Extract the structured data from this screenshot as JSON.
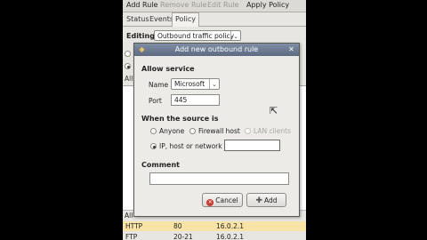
{
  "toolbar": {
    "add_rule": "Add Rule",
    "remove_rule": "Remove Rule",
    "edit_rule": "Edit Rule",
    "apply_policy": "Apply Policy"
  },
  "tabs": [
    "Status",
    "Events",
    "Policy"
  ],
  "editing": {
    "label": "Editing",
    "value": "Outbound traffic policy"
  },
  "background": {
    "list_header_1": "All",
    "list_header_2": "All",
    "rows": [
      {
        "service": "HTTP",
        "port": "80",
        "address": "16.0.2.1"
      },
      {
        "service": "FTP",
        "port": "20-21",
        "address": "16.0.2.1"
      }
    ]
  },
  "dialog": {
    "title": "Add new outbound rule",
    "allow_service": "Allow service",
    "name_label": "Name",
    "name_value": "Microsoft",
    "port_label": "Port",
    "port_value": "445",
    "source_heading": "When the source is",
    "radio_anyone": "Anyone",
    "radio_firewall": "Firewall host",
    "radio_lan": "LAN clients",
    "radio_ip": "IP, host or network",
    "ip_value": "",
    "comment_label": "Comment",
    "comment_value": "",
    "cancel_label": "Cancel",
    "add_label": "Add"
  },
  "colors": {
    "titlebar": "#6b7a92",
    "selected_row": "#f7e3a5"
  }
}
